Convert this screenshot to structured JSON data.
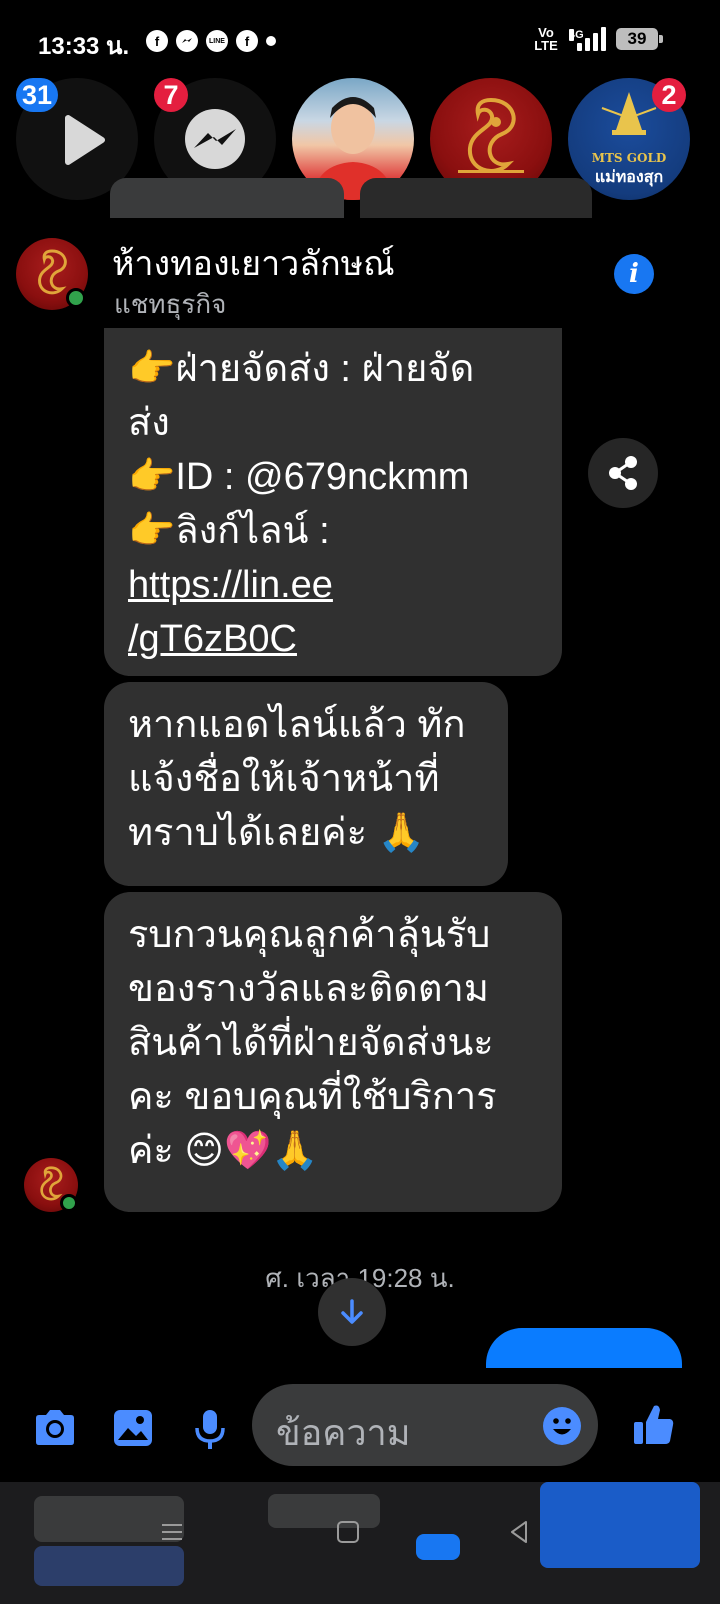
{
  "status_bar": {
    "time": "13:33 น.",
    "apps": [
      "f",
      "m",
      "LINE",
      "f"
    ],
    "volte": "Vo\nLTE",
    "network": "4G",
    "battery": "39"
  },
  "chat_heads": [
    {
      "name": "video-head",
      "badge": "31"
    },
    {
      "name": "messenger-head",
      "badge": "7"
    },
    {
      "name": "person-head",
      "badge": ""
    },
    {
      "name": "gold-shop-head",
      "badge": ""
    },
    {
      "name": "mts-gold-head",
      "badge": "2",
      "brand_line1": "MTS GOLD",
      "brand_line2": "แม่ทองสุก"
    }
  ],
  "header": {
    "name": "ห้างทองเยาวลักษณ์",
    "subtitle": "แชทธุรกิจ"
  },
  "messages": [
    {
      "id": "msg1",
      "lines": [
        "👉ฝ่ายจัดส่ง : ฝ่ายจัด",
        "ส่ง",
        "👉ID :  @679nckmm",
        "👉ลิงก์ไลน์ :"
      ],
      "link_lines": [
        "https://lin.ee",
        "/gT6zB0C"
      ]
    },
    {
      "id": "msg2",
      "lines": [
        "หากแอดไลน์แล้ว ทัก",
        "แจ้งชื่อให้เจ้าหน้าที่",
        "ทราบได้เลยค่ะ 🙏"
      ]
    },
    {
      "id": "msg3",
      "lines": [
        "รบกวนคุณลูกค้าลุ้นรับ",
        "ของรางวัลและติดตาม",
        "สินค้าได้ที่ฝ่ายจัดส่งนะ",
        "คะ ขอบคุณที่ใช้บริการ",
        "ค่ะ 😊💖🙏"
      ]
    }
  ],
  "timestamp": "ศ. เวลา 19:28 น.",
  "composer": {
    "placeholder": "ข้อความ"
  },
  "colors": {
    "accent": "#1877f2",
    "bubble_incoming": "#303030",
    "bubble_outgoing": "#0a7cff",
    "online": "#31a24c",
    "badge_red": "#e41e3f"
  },
  "icons": [
    "camera-icon",
    "image-icon",
    "microphone-icon",
    "emoji-icon",
    "thumbs-up-icon",
    "share-icon",
    "info-icon",
    "arrow-down-icon",
    "play-icon",
    "messenger-icon"
  ]
}
